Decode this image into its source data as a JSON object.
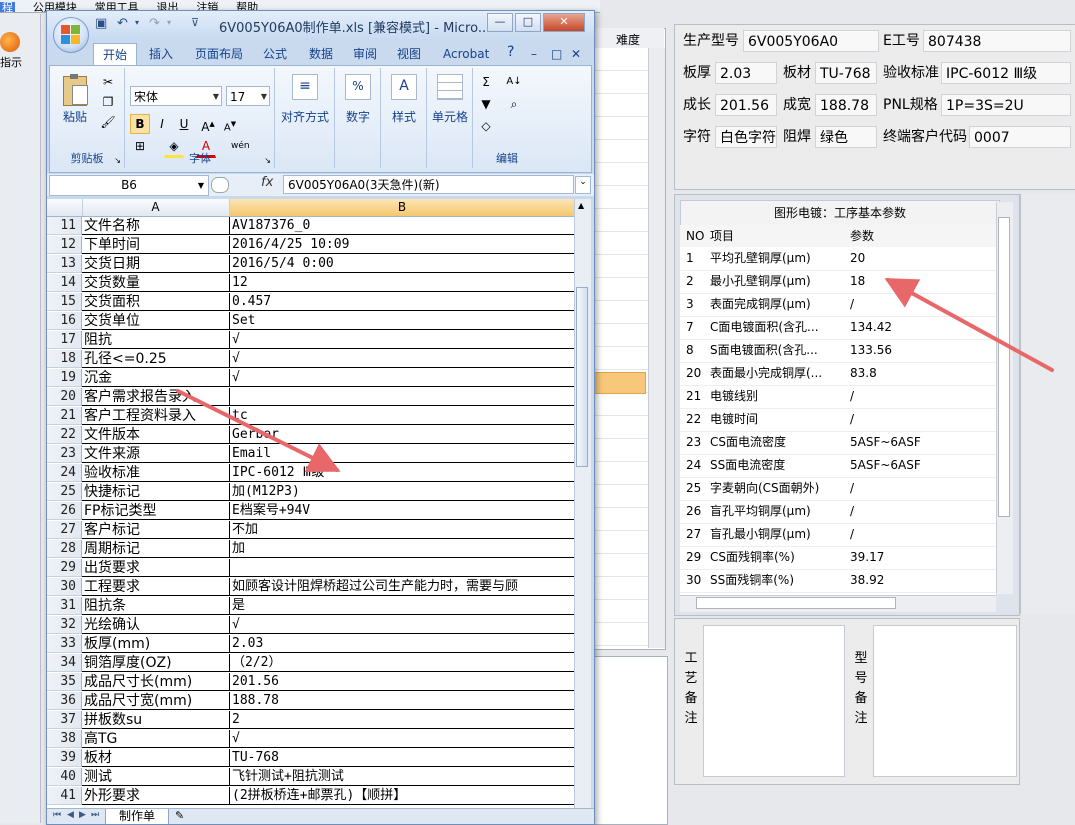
{
  "background_app": {
    "menu_items": [
      "程",
      "公用模块",
      "常用工具",
      "退出",
      "注销",
      "帮助"
    ],
    "guide_button_label": "指示",
    "grid_header": "难度"
  },
  "info": {
    "product_model_label": "生产型号",
    "product_model": "6V005Y06A0",
    "e_work_no_label": "E工号",
    "e_work_no": "807438",
    "board_thickness_label": "板厚",
    "board_thickness": "2.03",
    "board_material_label": "板材",
    "board_material": "TU-768",
    "acceptance_std_label": "验收标准",
    "acceptance_std": "IPC-6012 Ⅲ级",
    "finished_length_label": "成长",
    "finished_length": "201.56",
    "finished_width_label": "成宽",
    "finished_width": "188.78",
    "pnl_spec_label": "PNL规格",
    "pnl_spec": "1P=3S=2U",
    "legend_label": "字符",
    "legend": "白色字符",
    "solder_mask_label": "阻焊",
    "solder_mask": "绿色",
    "end_customer_label": "终端客户代码",
    "end_customer": "0007"
  },
  "params": {
    "title": "图形电镀：工序基本参数",
    "headers": {
      "no": "NO",
      "item": "项目",
      "value": "参数"
    },
    "rows": [
      {
        "no": "1",
        "item": "平均孔壁铜厚(μm)",
        "value": "20"
      },
      {
        "no": "2",
        "item": "最小孔壁铜厚(μm)",
        "value": "18"
      },
      {
        "no": "3",
        "item": "表面完成铜厚(μm)",
        "value": "/"
      },
      {
        "no": "7",
        "item": "C面电镀面积(含孔...",
        "value": "134.42"
      },
      {
        "no": "8",
        "item": "S面电镀面积(含孔...",
        "value": "133.56"
      },
      {
        "no": "20",
        "item": "表面最小完成铜厚(...",
        "value": "83.8"
      },
      {
        "no": "21",
        "item": "电镀线别",
        "value": "/"
      },
      {
        "no": "22",
        "item": "电镀时间",
        "value": "/"
      },
      {
        "no": "23",
        "item": "CS面电流密度",
        "value": "5ASF~6ASF"
      },
      {
        "no": "24",
        "item": "SS面电流密度",
        "value": "5ASF~6ASF"
      },
      {
        "no": "25",
        "item": "字麦朝向(CS面朝外)",
        "value": "/"
      },
      {
        "no": "26",
        "item": "盲孔平均铜厚(μm)",
        "value": "/"
      },
      {
        "no": "27",
        "item": "盲孔最小铜厚(μm)",
        "value": "/"
      },
      {
        "no": "29",
        "item": "CS面残铜率(%)",
        "value": "39.17"
      },
      {
        "no": "30",
        "item": "SS面残铜率(%)",
        "value": "38.92"
      }
    ]
  },
  "notes": {
    "process_label": [
      "工",
      "艺",
      "备",
      "注"
    ],
    "model_label": [
      "型",
      "号",
      "备",
      "注"
    ]
  },
  "excel": {
    "title": "6V005Y06A0制作单.xls  [兼容模式] - Micro...",
    "window_buttons": {
      "minimize": "—",
      "restore": "□",
      "close": "✕"
    },
    "ribbon_min": "–",
    "help": "?",
    "ribbon_close": "✕",
    "tabs": [
      "开始",
      "插入",
      "页面布局",
      "公式",
      "数据",
      "审阅",
      "视图",
      "Acrobat"
    ],
    "groups": {
      "clipboard": {
        "label": "剪贴板",
        "paste": "粘贴"
      },
      "font": {
        "label": "字体",
        "font_name": "宋体",
        "font_size": "17"
      },
      "align": {
        "label": "对齐方式"
      },
      "number": {
        "label": "数字"
      },
      "style": {
        "label": "样式"
      },
      "cells": {
        "label": "单元格"
      },
      "edit": {
        "label": "编辑"
      }
    },
    "name_box": "B6",
    "fx": "fx",
    "formula": "6V005Y06A0(3天急件)(新)",
    "col_a": "A",
    "col_b": "B",
    "sheet_tab": "制作单",
    "rows": [
      {
        "n": "11",
        "a": "文件名称",
        "b": "AV187376_0"
      },
      {
        "n": "12",
        "a": "下单时间",
        "b": "2016/4/25 10:09"
      },
      {
        "n": "13",
        "a": "交货日期",
        "b": "2016/5/4 0:00"
      },
      {
        "n": "14",
        "a": "交货数量",
        "b": "12"
      },
      {
        "n": "15",
        "a": "交货面积",
        "b": "0.457"
      },
      {
        "n": "16",
        "a": "交货单位",
        "b": "Set"
      },
      {
        "n": "17",
        "a": "阻抗",
        "b": "√"
      },
      {
        "n": "18",
        "a": "孔径<=0.25",
        "b": "√"
      },
      {
        "n": "19",
        "a": "沉金",
        "b": "√"
      },
      {
        "n": "20",
        "a": "客户需求报告录入",
        "b": ""
      },
      {
        "n": "21",
        "a": "客户工程资料录入",
        "b": "tc"
      },
      {
        "n": "22",
        "a": "文件版本",
        "b": "Gerber"
      },
      {
        "n": "23",
        "a": "文件来源",
        "b": "Email"
      },
      {
        "n": "24",
        "a": "验收标准",
        "b": "IPC-6012 Ⅲ级"
      },
      {
        "n": "25",
        "a": "快捷标记",
        "b": "加(M12P3)"
      },
      {
        "n": "26",
        "a": "FP标记类型",
        "b": "E档案号+94V"
      },
      {
        "n": "27",
        "a": "客户标记",
        "b": "不加"
      },
      {
        "n": "28",
        "a": "周期标记",
        "b": "加"
      },
      {
        "n": "29",
        "a": "出货要求",
        "b": ""
      },
      {
        "n": "30",
        "a": "工程要求",
        "b": "如顾客设计阻焊桥超过公司生产能力时，需要与顾"
      },
      {
        "n": "31",
        "a": "阻抗条",
        "b": "是"
      },
      {
        "n": "32",
        "a": "光绘确认",
        "b": "√"
      },
      {
        "n": "33",
        "a": "板厚(mm)",
        "b": "2.03"
      },
      {
        "n": "34",
        "a": "铜箔厚度(OZ)",
        "b": "（2/2）"
      },
      {
        "n": "35",
        "a": "成品尺寸长(mm)",
        "b": "201.56"
      },
      {
        "n": "36",
        "a": "成品尺寸宽(mm)",
        "b": "188.78"
      },
      {
        "n": "37",
        "a": "拼板数su",
        "b": "2"
      },
      {
        "n": "38",
        "a": "高TG",
        "b": "√"
      },
      {
        "n": "39",
        "a": "板材",
        "b": "TU-768"
      },
      {
        "n": "40",
        "a": "测试",
        "b": "飞针测试+阻抗测试"
      },
      {
        "n": "41",
        "a": "外形要求",
        "b": "(2拼板桥连+邮票孔)【顺拼】"
      }
    ]
  },
  "annotation_color": "#e8686a"
}
